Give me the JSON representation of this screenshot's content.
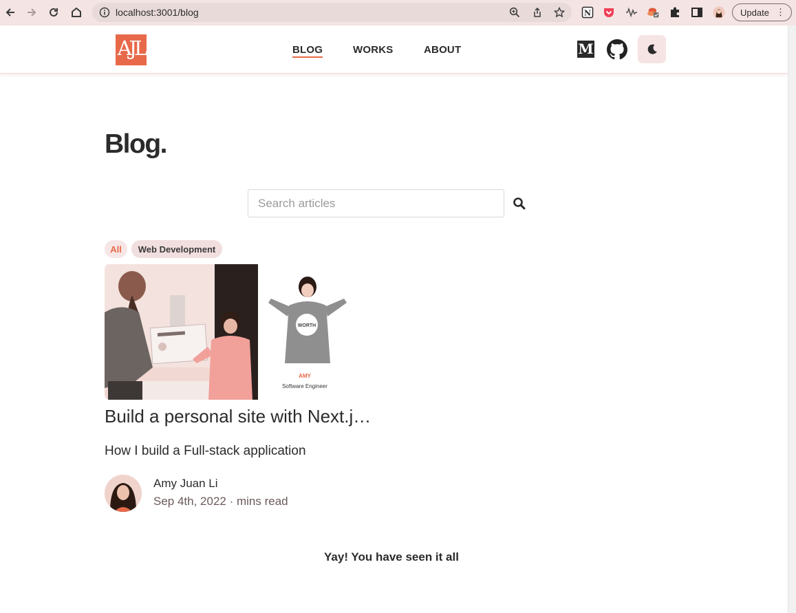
{
  "browser": {
    "url": "localhost:3001/blog",
    "update_label": "Update",
    "menu_glyph": "⋮",
    "notion_glyph": "N"
  },
  "site": {
    "logo_text": "AJL",
    "nav": [
      {
        "label": "BLOG",
        "active": true
      },
      {
        "label": "WORKS",
        "active": false
      },
      {
        "label": "ABOUT",
        "active": false
      }
    ],
    "medium_glyph": "M",
    "accent_color": "#e8694a"
  },
  "page": {
    "title": "Blog.",
    "search_placeholder": "Search articles",
    "categories": [
      {
        "label": "All",
        "selected": true
      },
      {
        "label": "Web Development",
        "selected": false
      }
    ]
  },
  "post": {
    "title": "Build a personal site with Next.j…",
    "subtitle": "How I build a Full-stack application",
    "author": "Amy Juan Li",
    "meta": "Sep 4th, 2022 · mins read",
    "image": {
      "sign_name": "AMY",
      "sign_role": "Software Engineer",
      "shirt_text": "WORTH"
    }
  },
  "footer": {
    "end_message": "Yay! You have seen it all"
  }
}
